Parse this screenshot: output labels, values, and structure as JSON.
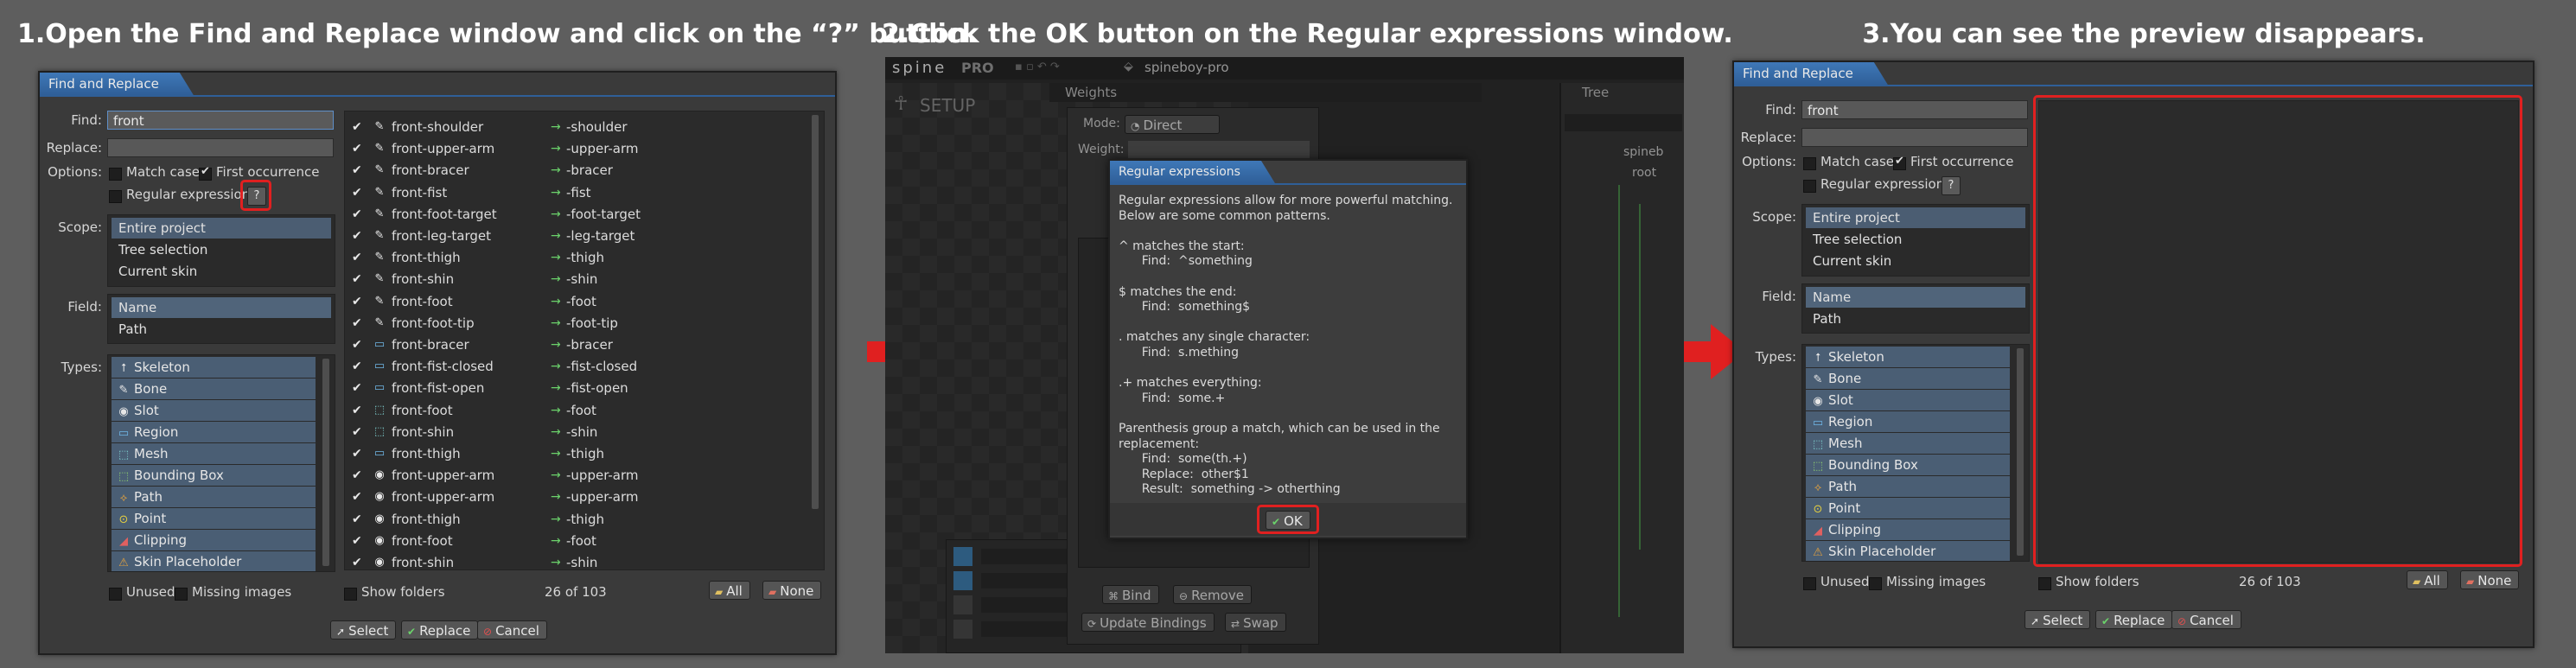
{
  "steps": [
    {
      "title": "1.Open the Find and Replace window and click on the “?” button."
    },
    {
      "title": "2.Click the OK button on the Regular expressions window."
    },
    {
      "title": "3.You can see the preview disappears."
    }
  ],
  "dialog": {
    "window_title": "Find and Replace",
    "find_label": "Find:",
    "find_value": "front",
    "replace_label": "Replace:",
    "replace_value": "",
    "options_label": "Options:",
    "match_case": "Match case",
    "first_occurrence": "First occurrence",
    "regex": "Regular expression",
    "help_button": "?",
    "scope_label": "Scope:",
    "scope_options": [
      "Entire project",
      "Tree selection",
      "Current skin"
    ],
    "field_label": "Field:",
    "field_options": [
      "Name",
      "Path"
    ],
    "types_label": "Types:",
    "types": [
      "Skeleton",
      "Bone",
      "Slot",
      "Region",
      "Mesh",
      "Bounding Box",
      "Path",
      "Point",
      "Clipping",
      "Skin Placeholder"
    ],
    "unused": "Unused",
    "missing_images": "Missing images",
    "show_folders": "Show folders",
    "count": "26 of 103",
    "all_button": "All",
    "none_button": "None",
    "select_button": "Select",
    "replace_button": "Replace",
    "cancel_button": "Cancel"
  },
  "results": [
    {
      "name": "front-shoulder",
      "new": "-shoulder",
      "icon": "bone"
    },
    {
      "name": "front-upper-arm",
      "new": "-upper-arm",
      "icon": "bone"
    },
    {
      "name": "front-bracer",
      "new": "-bracer",
      "icon": "bone"
    },
    {
      "name": "front-fist",
      "new": "-fist",
      "icon": "bone"
    },
    {
      "name": "front-foot-target",
      "new": "-foot-target",
      "icon": "bone"
    },
    {
      "name": "front-leg-target",
      "new": "-leg-target",
      "icon": "bone"
    },
    {
      "name": "front-thigh",
      "new": "-thigh",
      "icon": "bone"
    },
    {
      "name": "front-shin",
      "new": "-shin",
      "icon": "bone"
    },
    {
      "name": "front-foot",
      "new": "-foot",
      "icon": "bone"
    },
    {
      "name": "front-foot-tip",
      "new": "-foot-tip",
      "icon": "bone"
    },
    {
      "name": "front-bracer",
      "new": "-bracer",
      "icon": "region"
    },
    {
      "name": "front-fist-closed",
      "new": "-fist-closed",
      "icon": "region"
    },
    {
      "name": "front-fist-open",
      "new": "-fist-open",
      "icon": "region"
    },
    {
      "name": "front-foot",
      "new": "-foot",
      "icon": "mesh"
    },
    {
      "name": "front-shin",
      "new": "-shin",
      "icon": "mesh"
    },
    {
      "name": "front-thigh",
      "new": "-thigh",
      "icon": "region"
    },
    {
      "name": "front-upper-arm",
      "new": "-upper-arm",
      "icon": "slot"
    },
    {
      "name": "front-upper-arm",
      "new": "-upper-arm",
      "icon": "slot"
    },
    {
      "name": "front-thigh",
      "new": "-thigh",
      "icon": "slot"
    },
    {
      "name": "front-foot",
      "new": "-foot",
      "icon": "slot"
    },
    {
      "name": "front-shin",
      "new": "-shin",
      "icon": "slot"
    }
  ],
  "editor": {
    "logo": "spine",
    "pro": "PRO",
    "project": "spineboy-pro",
    "setup": "SETUP",
    "weights_tab": "Weights",
    "tree_tab": "Tree",
    "mode_label": "Mode:",
    "mode_value": "Direct",
    "weight_label": "Weight:",
    "bind": "Bind",
    "remove": "Remove",
    "update_bindings": "Update Bindings",
    "swap": "Swap",
    "tree_root": "spineb",
    "tree_child": "root"
  },
  "regex_window": {
    "title": "Regular expressions",
    "lines": [
      "Regular expressions allow for more powerful matching.",
      "Below are some common patterns.",
      "",
      "^ matches the start:",
      "      Find:  ^something",
      "",
      "$ matches the end:",
      "      Find:  something$",
      "",
      ". matches any single character:",
      "      Find:  s.mething",
      "",
      ".+ matches everything:",
      "      Find:  some.+",
      "",
      "Parenthesis group a match, which can be used in the",
      "replacement:",
      "      Find:  some(th.+)",
      "      Replace:  other$1",
      "      Result:  something -> otherthing"
    ],
    "ok_button": "OK"
  },
  "colors": {
    "accent": "#2f5f98",
    "highlight": "#e02020",
    "arrow": "#e02020"
  }
}
